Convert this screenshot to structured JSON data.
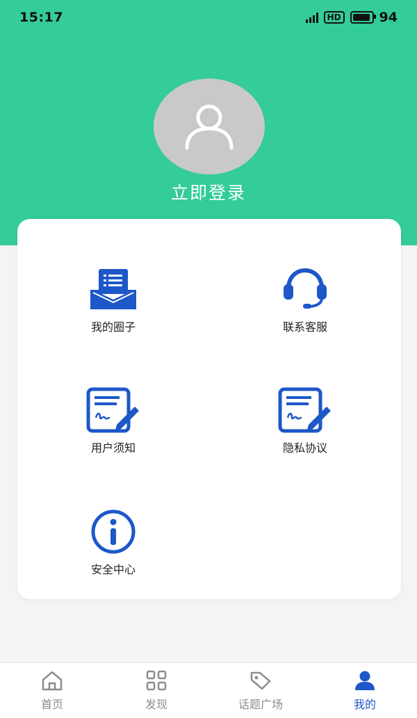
{
  "status_bar": {
    "time": "15:17",
    "network": "4G",
    "hd_label": "HD",
    "battery_level": "94"
  },
  "header": {
    "login_label": "立即登录",
    "avatar_icon": "user-icon",
    "background_color": "#34cc97"
  },
  "menu": {
    "items": [
      {
        "label": "我的圈子",
        "icon": "inbox-tray-icon"
      },
      {
        "label": "联系客服",
        "icon": "headset-icon"
      },
      {
        "label": "用户须知",
        "icon": "document-sign-icon"
      },
      {
        "label": "隐私协议",
        "icon": "document-sign-icon"
      },
      {
        "label": "安全中心",
        "icon": "info-circle-icon"
      }
    ],
    "accent_color": "#1d57c8"
  },
  "bottom_nav": {
    "items": [
      {
        "label": "首页",
        "icon": "home-icon",
        "active": false
      },
      {
        "label": "发现",
        "icon": "grid-icon",
        "active": false
      },
      {
        "label": "话题广场",
        "icon": "tag-icon",
        "active": false
      },
      {
        "label": "我的",
        "icon": "person-icon",
        "active": true
      }
    ],
    "active_color": "#1d57c8",
    "inactive_color": "#8c8c8c"
  }
}
